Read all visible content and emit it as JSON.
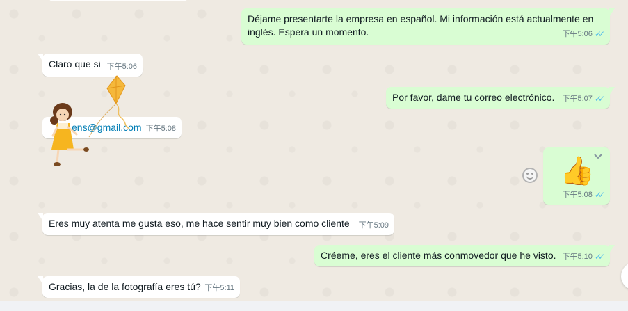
{
  "messages": [
    {
      "text": "Déjame presentarte la empresa en español. Mi información está actualmente en\ninglés. Espera un momento.",
      "time": "下午5:06"
    },
    {
      "text": "Claro que si",
      "time": "下午5:06"
    },
    {
      "text": "Por favor, dame tu correo electrónico.",
      "time": "下午5:07"
    },
    {
      "text_visible": "ens@gmail.com",
      "time": "下午5:08"
    },
    {
      "emoji": "👍",
      "time": "下午5:08"
    },
    {
      "text": "Eres muy atenta me gusta eso, me hace sentir muy bien como cliente",
      "time": "下午5:09"
    },
    {
      "text": "Créeme, eres el cliente más conmovedor que he visto.",
      "time": "下午5:10"
    },
    {
      "text": "Gracias, la de la fotografía eres tú?",
      "time": "下午5:11"
    }
  ],
  "colors": {
    "incoming": "#ffffff",
    "outgoing": "#d9fdd3",
    "read_ticks": "#53bdeb",
    "link": "#027eb5",
    "wallpaper": "#efeae2"
  },
  "icons": {
    "read_receipt": "double-check-icon",
    "reaction": "emoji-smiley-icon",
    "menu": "chevron-down-icon",
    "sticker": "girl-with-kite-sticker"
  }
}
